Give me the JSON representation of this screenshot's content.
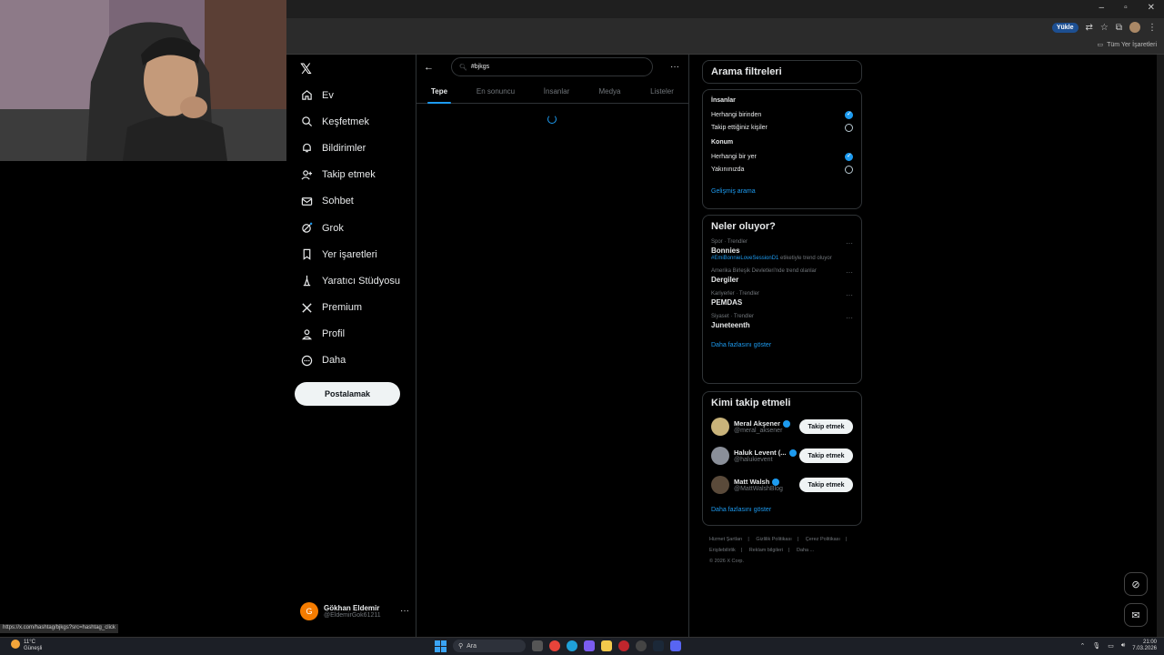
{
  "browser": {
    "upload_label": "Yükle",
    "bookmarks_label": "Tüm Yer İşaretleri",
    "status_url": "https://x.com/hashtag/bjkgs?src=hashtag_click"
  },
  "nav": {
    "items": [
      {
        "label": "Ev",
        "icon": "home-icon"
      },
      {
        "label": "Keşfetmek",
        "icon": "search-icon"
      },
      {
        "label": "Bildirimler",
        "icon": "bell-icon"
      },
      {
        "label": "Takip etmek",
        "icon": "add-user-icon"
      },
      {
        "label": "Sohbet",
        "icon": "mail-icon"
      },
      {
        "label": "Grok",
        "icon": "grok-icon"
      },
      {
        "label": "Yer işaretleri",
        "icon": "bookmark-icon"
      },
      {
        "label": "Yaratıcı Stüdyosu",
        "icon": "lightning-icon"
      },
      {
        "label": "Premium",
        "icon": "x-icon"
      },
      {
        "label": "Profil",
        "icon": "person-icon"
      },
      {
        "label": "Daha",
        "icon": "more-circle-icon"
      }
    ],
    "post_label": "Postalamak"
  },
  "account": {
    "initial": "G",
    "name": "Gökhan Eldemir",
    "handle": "@EldemirGok61211"
  },
  "search": {
    "query": "#bjkgs"
  },
  "tabs": [
    {
      "label": "Tepe",
      "active": true
    },
    {
      "label": "En sonuncu",
      "active": false
    },
    {
      "label": "İnsanlar",
      "active": false
    },
    {
      "label": "Medya",
      "active": false
    },
    {
      "label": "Listeler",
      "active": false
    }
  ],
  "filters": {
    "title": "Arama filtreleri",
    "people_header": "İnsanlar",
    "people_options": [
      {
        "label": "Herhangi birinden",
        "selected": true
      },
      {
        "label": "Takip ettiğiniz kişiler",
        "selected": false
      }
    ],
    "location_header": "Konum",
    "location_options": [
      {
        "label": "Herhangi bir yer",
        "selected": true
      },
      {
        "label": "Yakınınızda",
        "selected": false
      }
    ],
    "advanced_link": "Gelişmiş arama"
  },
  "trends": {
    "title": "Neler oluyor?",
    "items": [
      {
        "meta": "Spor · Trendler",
        "name": "Bonnies",
        "hashtag": "#EmiBonnieLoveSessionD1",
        "sub_suffix": " etiketiyle trend oluyor"
      },
      {
        "meta": "Amerika Birleşik Devletleri'nde trend olanlar",
        "name": "Dergiler"
      },
      {
        "meta": "Kariyerler · Trendler",
        "name": "PEMDAS"
      },
      {
        "meta": "Siyaset · Trendler",
        "name": "Juneteenth"
      }
    ],
    "more_link": "Daha fazlasını göster"
  },
  "who_to_follow": {
    "title": "Kimi takip etmeli",
    "follow_label": "Takip etmek",
    "users": [
      {
        "name": "Meral Akşener",
        "handle": "@meral_aksener",
        "color": "#c9b37a"
      },
      {
        "name": "Haluk Levent (...",
        "handle": "@halukievent",
        "color": "#8a8f99"
      },
      {
        "name": "Matt Walsh",
        "handle": "@MattWalshBlog",
        "color": "#5a4a3a"
      }
    ],
    "more_link": "Daha fazlasını göster"
  },
  "footer": {
    "links": [
      "Hizmet Şartları",
      "|",
      "Gizlilik Politikası",
      "|",
      "Çerez Politikası",
      "|",
      "Erişilebilirlik",
      "|",
      "Reklam bilgileri",
      "|",
      "Daha ...",
      "© 2026 X Corp."
    ]
  },
  "taskbar": {
    "temp": "11°C",
    "weather": "Güneşli",
    "search_label": "Ara",
    "time": "21:00",
    "date": "7.03.2026"
  },
  "colors": {
    "accent": "#1d9bf0",
    "background": "#000000"
  }
}
